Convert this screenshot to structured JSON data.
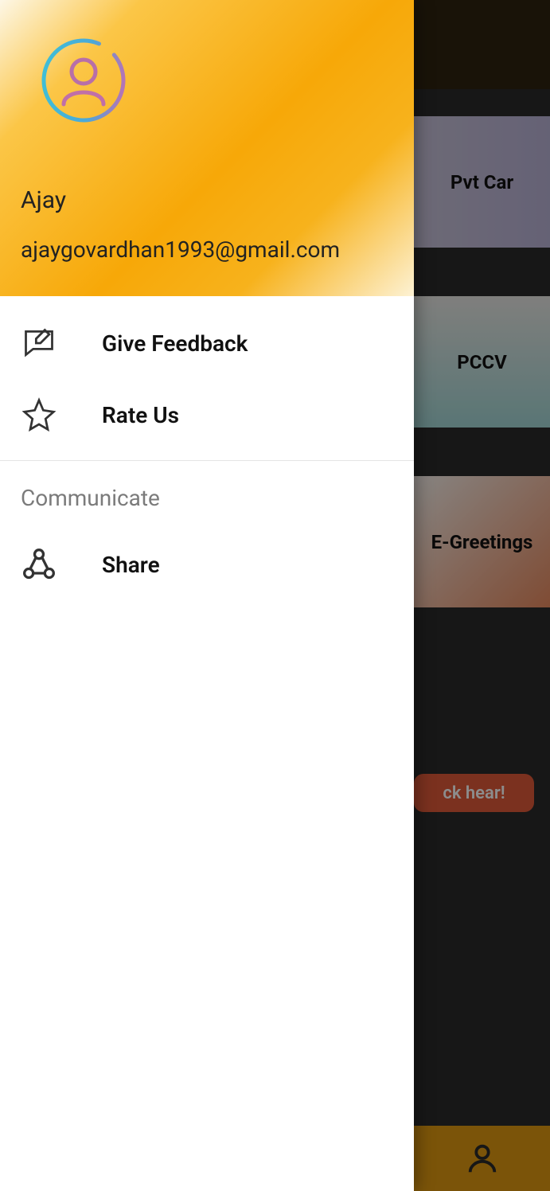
{
  "profile": {
    "name": "Ajay",
    "email": "ajaygovardhan1993@gmail.com"
  },
  "menu": {
    "feedback_label": "Give Feedback",
    "rate_label": "Rate Us",
    "share_label": "Share"
  },
  "section": {
    "communicate_label": "Communicate"
  },
  "background": {
    "card1_label": "Pvt Car",
    "card2_label": "PCCV",
    "card3_label": "E-Greetings",
    "cta_partial": "ck hear!"
  },
  "colors": {
    "drawer_header_accent": "#f7a808",
    "bottom_bar": "#e19a12",
    "cta_button": "#e15a3a"
  }
}
